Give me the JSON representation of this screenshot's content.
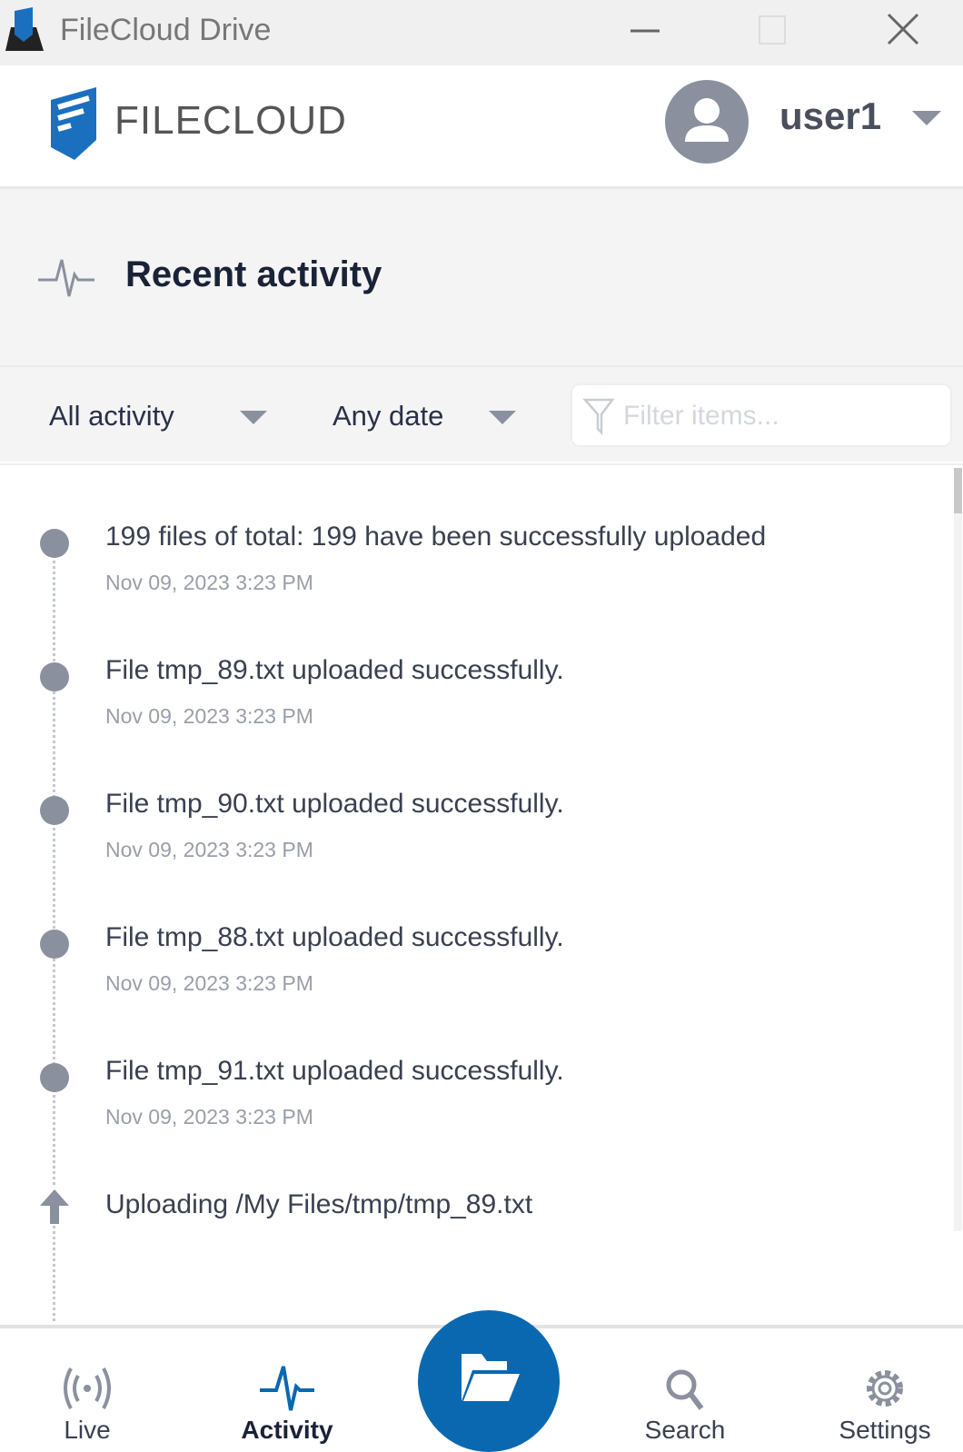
{
  "window": {
    "title": "FileCloud Drive"
  },
  "header": {
    "logo_text": "FILECLOUD",
    "username": "user1"
  },
  "page": {
    "title": "Recent activity"
  },
  "filters": {
    "activity": "All activity",
    "date": "Any date",
    "filter_placeholder": "Filter items..."
  },
  "activity": [
    {
      "text": "199 files of total: 199 have been successfully uploaded",
      "date": "Nov 09, 2023 3:23 PM",
      "icon": "dot"
    },
    {
      "text": "File tmp_89.txt uploaded successfully.",
      "date": "Nov 09, 2023 3:23 PM",
      "icon": "dot"
    },
    {
      "text": "File tmp_90.txt uploaded successfully.",
      "date": "Nov 09, 2023 3:23 PM",
      "icon": "dot"
    },
    {
      "text": "File tmp_88.txt uploaded successfully.",
      "date": "Nov 09, 2023 3:23 PM",
      "icon": "dot"
    },
    {
      "text": "File tmp_91.txt uploaded successfully.",
      "date": "Nov 09, 2023 3:23 PM",
      "icon": "dot"
    },
    {
      "text": "Uploading /My Files/tmp/tmp_89.txt",
      "icon": "upload-arrow"
    }
  ],
  "nav": {
    "live": "Live",
    "activity": "Activity",
    "search": "Search",
    "settings": "Settings"
  },
  "colors": {
    "accent": "#0a68b0",
    "muted": "#8a909e",
    "title": "#1a2238"
  }
}
